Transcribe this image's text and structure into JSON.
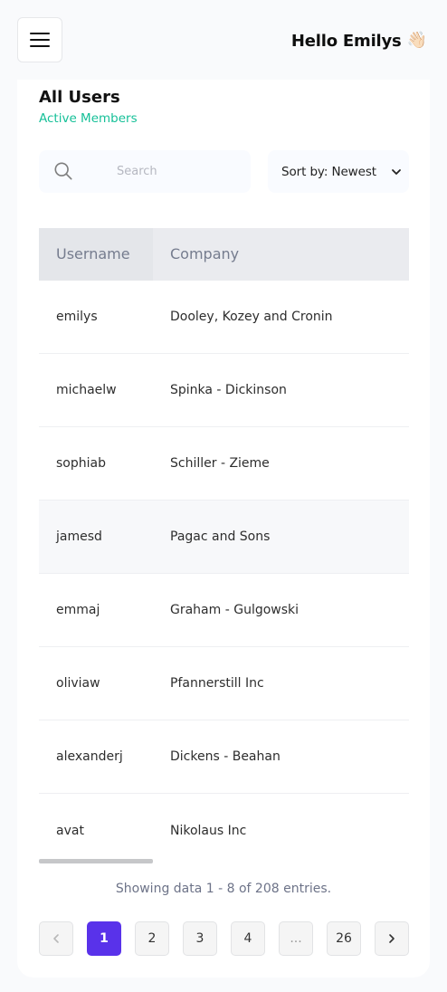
{
  "header": {
    "greeting": "Hello Emilys",
    "wave_emoji": "👋🏻"
  },
  "card": {
    "title": "All Users",
    "subtitle": "Active Members"
  },
  "search": {
    "placeholder": "Search",
    "value": ""
  },
  "sort": {
    "label": "Sort by: Newest"
  },
  "table": {
    "headers": [
      "Username",
      "Company"
    ],
    "rows": [
      {
        "username": "emilys",
        "company": "Dooley, Kozey and Cronin"
      },
      {
        "username": "michaelw",
        "company": "Spinka - Dickinson"
      },
      {
        "username": "sophiab",
        "company": "Schiller - Zieme"
      },
      {
        "username": "jamesd",
        "company": "Pagac and Sons"
      },
      {
        "username": "emmaj",
        "company": "Graham - Gulgowski"
      },
      {
        "username": "oliviaw",
        "company": "Pfannerstill Inc"
      },
      {
        "username": "alexanderj",
        "company": "Dickens - Beahan"
      },
      {
        "username": "avat",
        "company": "Nikolaus Inc"
      }
    ]
  },
  "footer": {
    "showing": "Showing data 1 - 8 of 208 entries."
  },
  "pagination": {
    "prev_icon": "chevron-left-icon",
    "pages": [
      "1",
      "2",
      "3",
      "4",
      "...",
      "26"
    ],
    "active": "1",
    "next_icon": "chevron-right-icon"
  },
  "colors": {
    "accent": "#5932ea",
    "subtitle": "#16c098"
  }
}
